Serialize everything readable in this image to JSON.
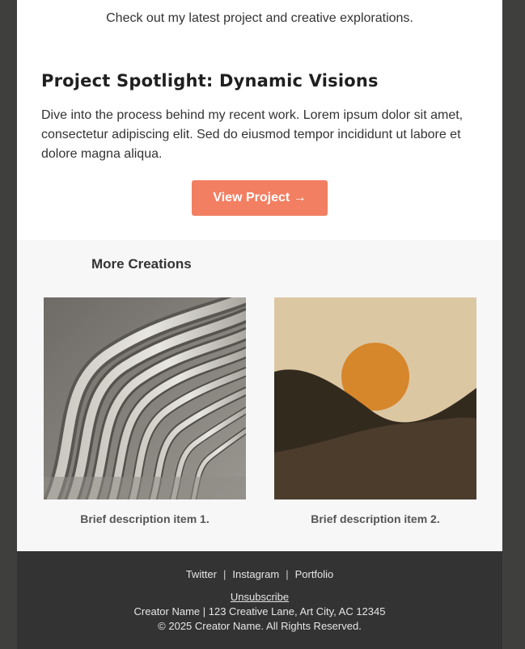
{
  "intro": {
    "text": "Check out my latest project and creative explorations."
  },
  "spotlight": {
    "title": "Project Spotlight: Dynamic Visions",
    "body": "Dive into the process behind my recent work. Lorem ipsum dolor sit amet, consectetur adipiscing elit. Sed do eiusmod tempor incididunt ut labore et dolore magna aliqua.",
    "button_label": "View Project →",
    "button_color": "#f27f62"
  },
  "more": {
    "title": "More Creations",
    "items": [
      {
        "image": "abstract-wave-architecture-image",
        "caption": "Brief description item 1."
      },
      {
        "image": "desert-sun-landscape-image",
        "caption": "Brief description item 2."
      }
    ]
  },
  "footer": {
    "social": [
      "Twitter",
      "Instagram",
      "Portfolio"
    ],
    "separator": "|",
    "unsubscribe": "Unsubscribe",
    "address": "Creator Name | 123 Creative Lane, Art City, AC 12345",
    "copyright": "© 2025 Creator Name. All Rights Reserved."
  },
  "colors": {
    "background": "#3f3f3d",
    "content": "#ffffff",
    "section": "#f7f7f7",
    "footer": "#333333",
    "accent": "#f27f62"
  }
}
